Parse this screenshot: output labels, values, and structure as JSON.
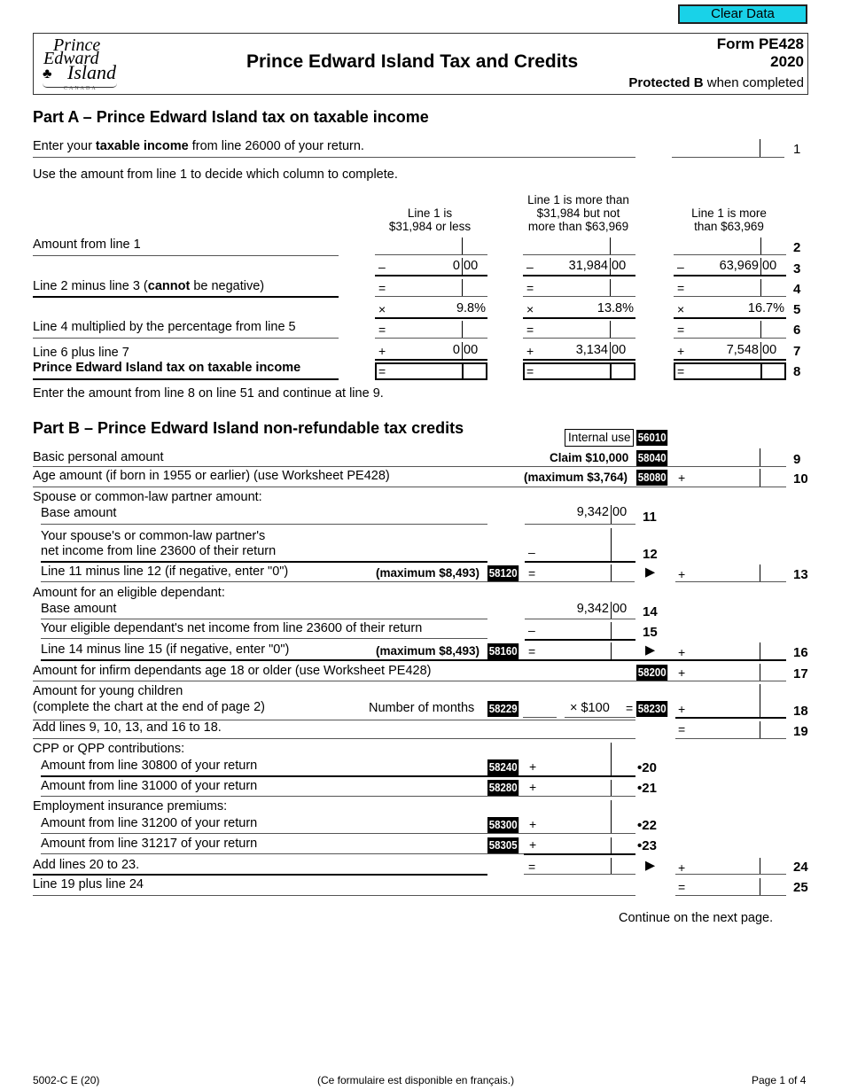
{
  "toolbar": {
    "clear_label": "Clear Data",
    "accent_color": "#19d2e8"
  },
  "header": {
    "logo": {
      "line1": "Prince",
      "line2": "Edward",
      "line3": "Island",
      "country": "CANADA"
    },
    "title": "Prince Edward Island Tax and Credits",
    "form_name": "Form PE428",
    "year": "2020",
    "protected_bold": "Protected B",
    "protected_rest": " when completed"
  },
  "part_a": {
    "heading": "Part A – Prince Edward Island tax on taxable income",
    "line1": {
      "pre": "Enter your ",
      "bold": "taxable income",
      "post": " from line 26000 of your return.",
      "no": "1"
    },
    "instruction": "Use the amount from line 1 to decide which column to complete.",
    "columns": [
      {
        "header": [
          "Line 1 is",
          "$31,984 or less"
        ],
        "line3": [
          "0",
          "00"
        ],
        "rate": "9.8%",
        "line7": [
          "0",
          "00"
        ]
      },
      {
        "header": [
          "Line 1 is more than",
          "$31,984 but not",
          "more than $63,969"
        ],
        "line3": [
          "31,984",
          "00"
        ],
        "rate": "13.8%",
        "line7": [
          "3,134",
          "00"
        ]
      },
      {
        "header": [
          "Line 1 is more",
          "than $63,969"
        ],
        "line3": [
          "63,969",
          "00"
        ],
        "rate": "16.7%",
        "line7": [
          "7,548",
          "00"
        ]
      }
    ],
    "rows": [
      {
        "label": "Amount from line 1",
        "no": "2",
        "sym": ""
      },
      {
        "label": "",
        "no": "3",
        "sym": "–"
      },
      {
        "label_pre": "Line 2 minus line 3 (",
        "label_bold": "cannot",
        "label_post": " be negative)",
        "no": "4",
        "sym": "="
      },
      {
        "label": "",
        "no": "5",
        "sym": "×"
      },
      {
        "label": "Line 4 multiplied by the percentage from line 5",
        "no": "6",
        "sym": "="
      },
      {
        "label": "Line 6 plus line 7",
        "no": "7",
        "sym": "+"
      },
      {
        "label": "Prince Edward Island tax on taxable income",
        "no": "8",
        "sym": "="
      }
    ],
    "footer_note": "Enter the amount from line 8 on line 51 and continue at line 9."
  },
  "part_b": {
    "heading": "Part B – Prince Edward Island non-refundable tax credits",
    "internal_use": {
      "label": "Internal use",
      "code": "56010"
    },
    "lines": {
      "l9": {
        "label": "Basic personal amount",
        "note": "Claim $10,000",
        "code": "58040",
        "no": "9"
      },
      "l10": {
        "label": "Age amount (if born in 1955 or earlier) (use Worksheet PE428)",
        "note": "(maximum $3,764)",
        "code": "58080",
        "sym": "+",
        "no": "10"
      },
      "spouse_heading": "Spouse or common-law partner amount:",
      "l11": {
        "label": "Base amount",
        "value": [
          "9,342",
          "00"
        ],
        "no": "11"
      },
      "l12": {
        "label1": "Your spouse's or common-law partner's",
        "label2": "net income from line 23600 of their return",
        "sym": "–",
        "no": "12"
      },
      "l13": {
        "label": "Line 11 minus line 12 (if negative, enter \"0\")",
        "note": "(maximum $8,493)",
        "code": "58120",
        "sym": "=",
        "sym2": "+",
        "no": "13"
      },
      "dep_heading": "Amount for an eligible dependant:",
      "l14": {
        "label": "Base amount",
        "value": [
          "9,342",
          "00"
        ],
        "no": "14"
      },
      "l15": {
        "label": "Your eligible dependant's net income from line 23600 of their return",
        "sym": "–",
        "no": "15"
      },
      "l16": {
        "label": "Line 14 minus line 15 (if negative, enter \"0\")",
        "note": "(maximum $8,493)",
        "code": "58160",
        "sym": "=",
        "sym2": "+",
        "no": "16"
      },
      "l17": {
        "label": "Amount for infirm dependants age 18 or older (use Worksheet PE428)",
        "code": "58200",
        "sym": "+",
        "no": "17"
      },
      "l18": {
        "label1": "Amount for young children",
        "label2": "(complete the chart at the end of page 2)",
        "months_label": "Number of months",
        "months_code": "58229",
        "mult": "× $100",
        "eq": "=",
        "code": "58230",
        "sym": "+",
        "no": "18"
      },
      "l19": {
        "label": "Add lines 9, 10, 13, and 16 to 18.",
        "sym": "=",
        "no": "19"
      },
      "cpp_heading": "CPP or QPP contributions:",
      "l20": {
        "label": "Amount from line 30800 of your return",
        "code": "58240",
        "sym": "+",
        "no": "•20"
      },
      "l21": {
        "label": "Amount from line 31000 of your return",
        "code": "58280",
        "sym": "+",
        "no": "•21"
      },
      "ei_heading": "Employment insurance premiums:",
      "l22": {
        "label": "Amount from line 31200 of your return",
        "code": "58300",
        "sym": "+",
        "no": "•22"
      },
      "l23": {
        "label": "Amount from line 31217 of your return",
        "code": "58305",
        "sym": "+",
        "no": "•23"
      },
      "l24": {
        "label": "Add lines 20 to 23.",
        "sym": "=",
        "sym2": "+",
        "no": "24"
      },
      "l25": {
        "label": "Line 19 plus line 24",
        "sym": "=",
        "no": "25"
      }
    },
    "arrow": "▶",
    "continue": "Continue on the next page."
  },
  "footer": {
    "form_code": "5002-C E (20)",
    "french": "(Ce formulaire est disponible en français.)",
    "page": "Page 1 of 4"
  }
}
